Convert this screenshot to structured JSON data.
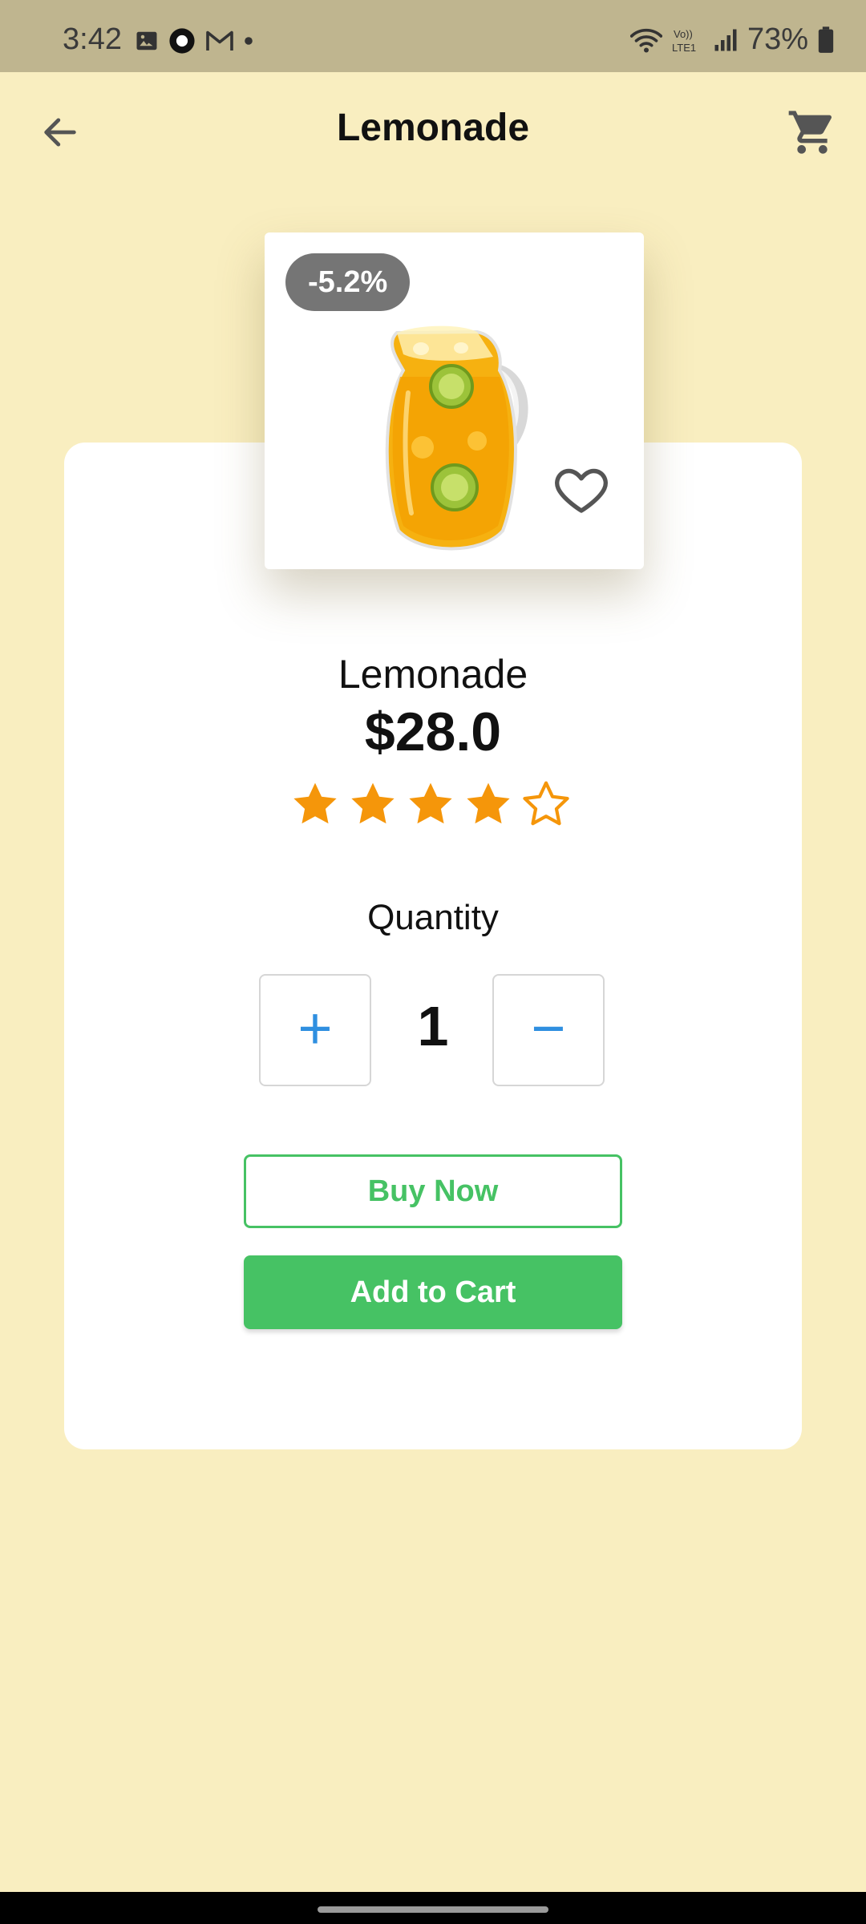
{
  "status_bar": {
    "time": "3:42",
    "notification_icons": [
      "gallery-icon",
      "app-icon",
      "gmail-icon",
      "dot-icon"
    ],
    "battery": "73%"
  },
  "app_bar": {
    "title": "Lemonade",
    "back_icon": "arrow-back-icon",
    "cart_icon": "shopping-cart-icon"
  },
  "product": {
    "discount": "-5.2%",
    "name": "Lemonade",
    "price": "$28.0",
    "rating": 4,
    "rating_max": 5,
    "favorite": false
  },
  "quantity": {
    "label": "Quantity",
    "value": "1",
    "plus_label": "+",
    "minus_label": "−"
  },
  "actions": {
    "buy_now": "Buy Now",
    "add_to_cart": "Add to Cart"
  },
  "colors": {
    "background": "#f9eec0",
    "status_bar": "#bfb58f",
    "accent_green": "#46c264",
    "star": "#f5960a",
    "qty_blue": "#2f8fe0"
  }
}
